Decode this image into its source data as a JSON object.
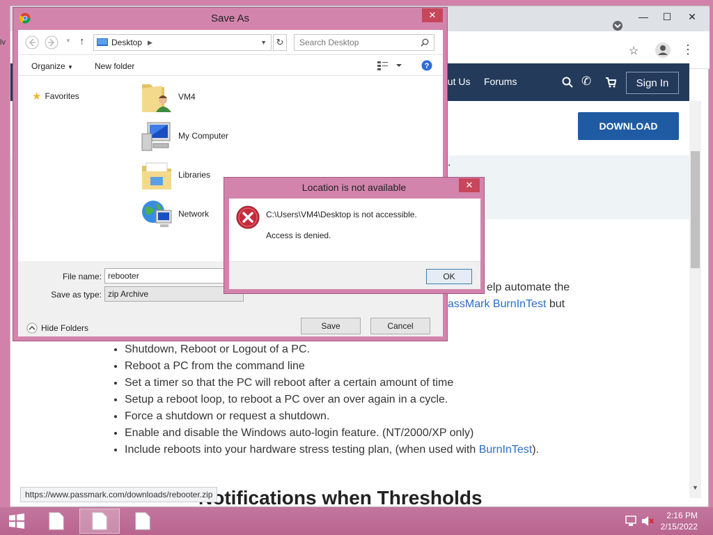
{
  "desktop": {
    "strip_text": "lv"
  },
  "browser": {
    "nav": {
      "about": "out Us",
      "forums": "Forums",
      "signin": "Sign In"
    },
    "download_label": "DOWNLOAD",
    "band_dot": ".",
    "para_line1": "elp automate the",
    "para_line2_link": "assMark BurnInTest",
    "para_line2_rest": " but",
    "bullets": [
      "Shutdown, Reboot or Logout of a PC.",
      "Reboot a PC from the command line",
      "Set a timer so that the PC will reboot after a certain amount of time",
      "Setup a reboot loop, to reboot a PC over an over again in a cycle.",
      "Force a shutdown or request a shutdown.",
      "Enable and disable the Windows auto-login feature. (NT/2000/XP only)"
    ],
    "bullet_last_pre": "Include reboots into your hardware stress testing plan, (when used with ",
    "bullet_last_link": "BurnInTest",
    "bullet_last_post": ").",
    "heading_partial": "Notifications when Thresholds",
    "status_url": "https://www.passmark.com/downloads/rebooter.zip"
  },
  "saveas": {
    "title": "Save As",
    "location": "Desktop",
    "search_placeholder": "Search Desktop",
    "organize": "Organize",
    "new_folder": "New folder",
    "favorites": "Favorites",
    "items": [
      "VM4",
      "My Computer",
      "Libraries",
      "Network"
    ],
    "file_name_label": "File name:",
    "file_name_value": "rebooter",
    "save_type_label": "Save as type:",
    "save_type_value": "zip Archive",
    "hide_folders": "Hide Folders",
    "save": "Save",
    "cancel": "Cancel"
  },
  "error": {
    "title": "Location is not available",
    "message": "C:\\Users\\VM4\\Desktop is not accessible.",
    "detail": "Access is denied.",
    "ok": "OK"
  },
  "taskbar": {
    "time": "2:16 PM",
    "date": "2/15/2022"
  },
  "colors": {
    "nav_bg": "#233a5a",
    "download_bg": "#1f5ba3",
    "link": "#2a6cc6",
    "window_frame": "#d384ad",
    "error_red": "#c42b3c"
  }
}
